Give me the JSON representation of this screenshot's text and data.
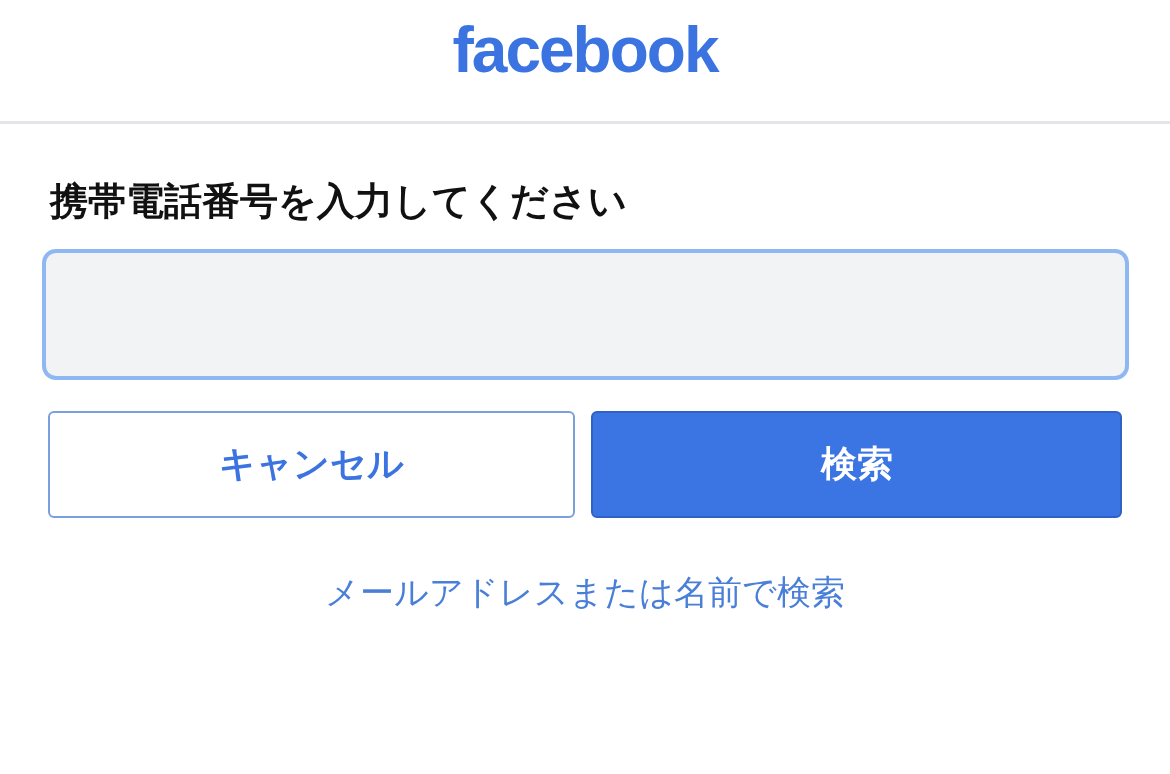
{
  "header": {
    "logo": "facebook"
  },
  "form": {
    "label": "携帯電話番号を入力してください",
    "phone_field": {
      "focused": true
    },
    "buttons": [
      {
        "label": "キャンセル",
        "kind": "secondary"
      },
      {
        "label": "検索",
        "kind": "primary"
      }
    ],
    "link": "メールアドレスまたは名前で検索"
  }
}
